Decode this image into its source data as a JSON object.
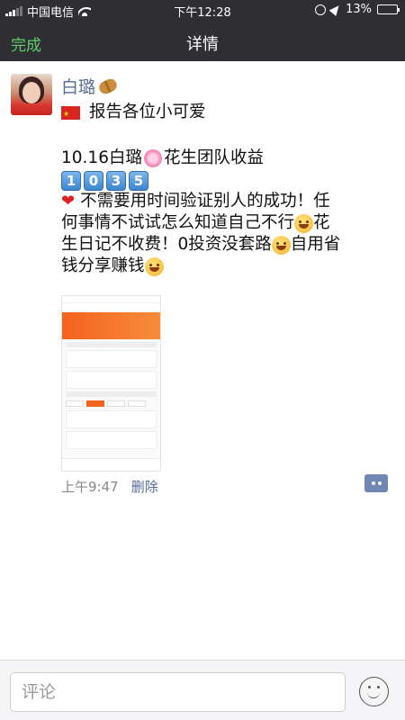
{
  "statusbar": {
    "carrier": "中国电信",
    "time": "下午12:28",
    "battery": "13%",
    "battery_level": 0.13
  },
  "navbar": {
    "done": "完成",
    "title": "详情"
  },
  "post": {
    "author": "白璐",
    "lines": {
      "l1": "报告各位小可爱",
      "l2a": "10.16白璐",
      "l2b": "花生团队收益",
      "digits": [
        "1",
        "0",
        "3",
        "5"
      ],
      "l4": "不需要用时间验证别人的成功！任",
      "l5": "何事情不试试怎么知道自己不行",
      "l5b": "花",
      "l6": "生日记不收费！0投资没套路",
      "l6b": "自用省",
      "l7": "钱分享赚钱"
    },
    "time": "上午9:47",
    "delete": "删除"
  },
  "comment": {
    "placeholder": "评论"
  },
  "icons": {
    "signal": "signal-icon",
    "wifi": "wifi-icon",
    "battery": "battery-icon",
    "emoji": "emoji-face-icon",
    "more": "more-dots-icon"
  },
  "colors": {
    "header": "#2e2e33",
    "done_green": "#5fd06c",
    "name_blue": "#576b95"
  }
}
